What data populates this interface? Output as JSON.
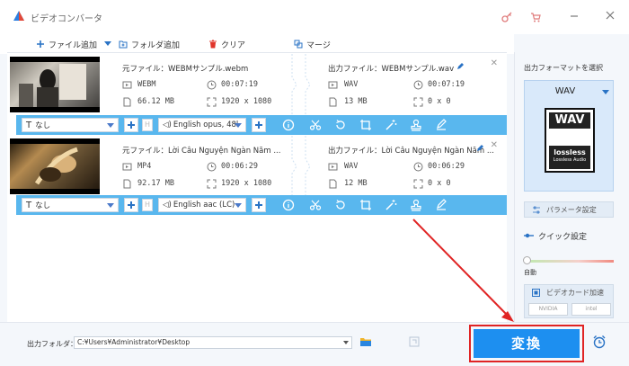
{
  "app": {
    "title": "ビデオコンバータ"
  },
  "toolbar": {
    "add_file": "ファイル追加",
    "add_folder": "フォルダ追加",
    "clear": "クリア",
    "merge": "マージ"
  },
  "items": [
    {
      "source_label": "元ファイル：",
      "source_name": "WEBMサンプル.webm",
      "output_label": "出力ファイル：",
      "output_name": "WEBMサンプル.wav",
      "src": {
        "format": "WEBM",
        "duration": "00:07:19",
        "size": "66.12 MB",
        "resolution": "1920 x 1080"
      },
      "dst": {
        "format": "WAV",
        "duration": "00:07:19",
        "size": "13 MB",
        "resolution": "0 x 0"
      },
      "subtitle": "なし",
      "audio": "English opus, 48l"
    },
    {
      "source_label": "元ファイル：",
      "source_name": "Lời Câu Nguyện Ngàn Năm ...",
      "output_label": "出力ファイル：",
      "output_name": "Lời Câu Nguyện Ngàn Năm ...",
      "src": {
        "format": "MP4",
        "duration": "00:06:29",
        "size": "92.17 MB",
        "resolution": "1920 x 1080"
      },
      "dst": {
        "format": "WAV",
        "duration": "00:06:29",
        "size": "12 MB",
        "resolution": "0 x 0"
      },
      "subtitle": "なし",
      "audio": "English aac (LC)"
    }
  ],
  "panel": {
    "title": "出力フォーマットを選択",
    "format": "WAV",
    "art_top": "WAV",
    "art_bottom": "lossless",
    "art_caption": "Lossless Audio",
    "param_label": "パラメータ設定",
    "quick_label": "クイック設定",
    "slider_label": "自動",
    "gpu_label": "ビデオカード加速",
    "chip_nvidia": "NVIDIA",
    "chip_intel": "intel"
  },
  "bottom": {
    "output_label": "出力フォルダ：",
    "output_path": "C:¥Users¥Administrator¥Desktop",
    "convert_label": "変換"
  },
  "colors": {
    "accent": "#1d8ff0",
    "bar": "#59b7ee",
    "highlight": "#e02424"
  }
}
